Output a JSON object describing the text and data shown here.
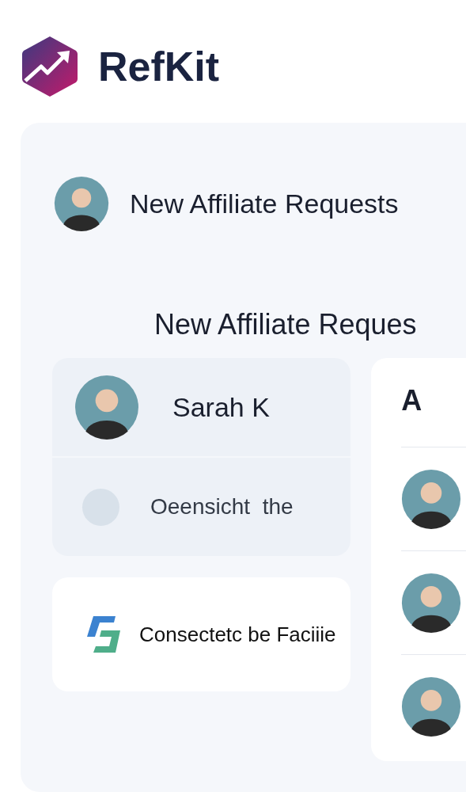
{
  "brand": {
    "name": "RefKit"
  },
  "header": {
    "title": "New Affiliate Requests"
  },
  "section": {
    "title": "New Affiliate Reques"
  },
  "request_card": {
    "name": "Sarah K",
    "note": "Oeensicht  the"
  },
  "partner_card": {
    "label": "Consectetc be Faciiie"
  },
  "side_panel": {
    "title": "A",
    "rows": [
      {
        "kind": "avatar"
      },
      {
        "kind": "avatar"
      },
      {
        "kind": "avatar"
      }
    ]
  }
}
